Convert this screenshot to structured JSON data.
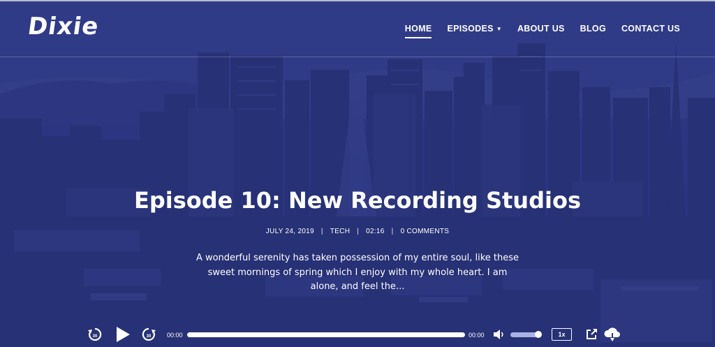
{
  "brand": {
    "logo_text": "Dixie"
  },
  "nav": {
    "items": [
      {
        "label": "HOME",
        "active": true
      },
      {
        "label": "EPISODES",
        "has_dropdown": true
      },
      {
        "label": "ABOUT US"
      },
      {
        "label": "BLOG"
      },
      {
        "label": "CONTACT US"
      }
    ]
  },
  "episode": {
    "title": "Episode 10: New Recording Studios",
    "date": "JULY 24, 2019",
    "category": "TECH",
    "duration": "02:16",
    "comments": "0 COMMENTS",
    "excerpt": "A wonderful serenity has taken possession of my entire soul, like these sweet mornings of spring which I enjoy with my whole heart. I am alone, and feel the..."
  },
  "player": {
    "current_time": "00:00",
    "total_time": "00:00",
    "skip_back_seconds": "30",
    "skip_forward_seconds": "30",
    "speed_label": "1x",
    "progress": 0,
    "volume": 0.85
  },
  "colors": {
    "overlay": "#2b3580",
    "accent": "#ffffff"
  }
}
